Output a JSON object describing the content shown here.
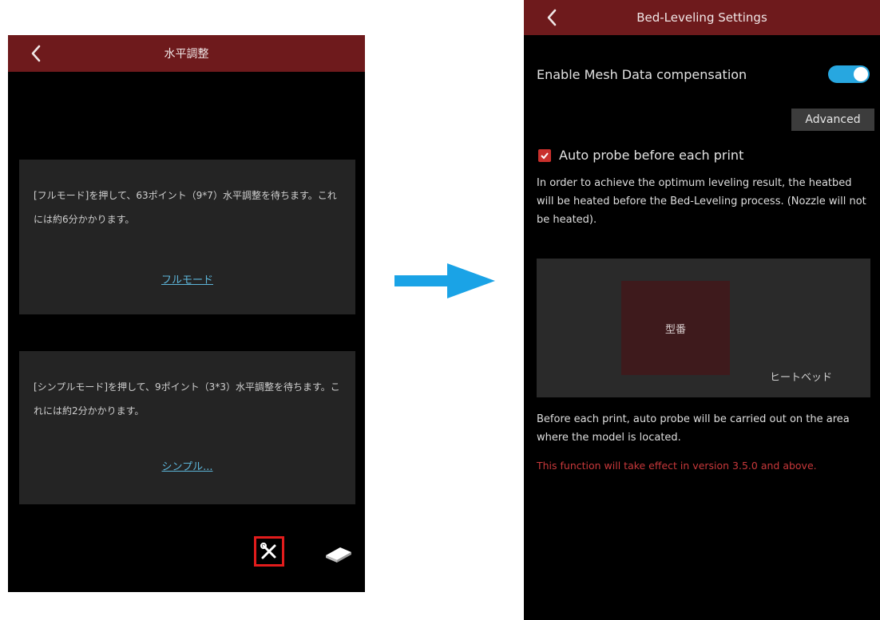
{
  "colors": {
    "header": "#6e1a1c",
    "accent_blue": "#27a7e0",
    "warning_red": "#c8383a",
    "highlight_red": "#e21c1c"
  },
  "left_screen": {
    "title": "水平調整",
    "full_card": {
      "text": "[フルモード]を押して、63ポイント（9*7）水平調整を待ちます。これには約6分かかります。",
      "link": "フルモード"
    },
    "simple_card": {
      "text": "[シンプルモード]を押して、9ポイント（3*3）水平調整を待ちます。これには約2分かかります。",
      "link": "シンプル..."
    },
    "tool_icon": "tools-icon",
    "bed_icon": "print-bed-icon"
  },
  "right_screen": {
    "title": "Bed-Leveling Settings",
    "mesh_label": "Enable Mesh Data compensation",
    "mesh_enabled": true,
    "advanced_button": "Advanced",
    "auto_probe_label": "Auto probe before each print",
    "auto_probe_checked": true,
    "description": "In order to achieve the optimum leveling result, the heatbed will be heated before the Bed-Leveling process. (Nozzle will not be heated).",
    "model_label": "型番",
    "heatbed_label": "ヒートベッド",
    "note": "Before each print, auto probe will be carried out on the area where the model is located.",
    "warning": "This function will take effect in version 3.5.0 and above."
  }
}
